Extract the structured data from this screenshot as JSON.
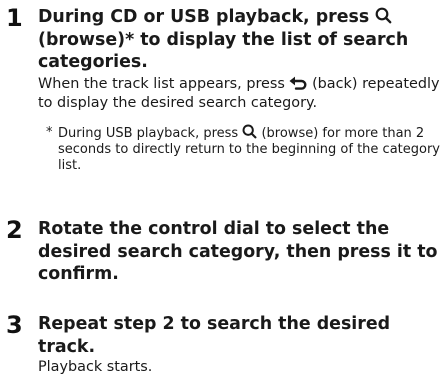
{
  "steps": [
    {
      "number": "1",
      "heading": {
        "before": "During CD or USB playback, press",
        "after": "(browse)* to display the list of search categories."
      },
      "body": {
        "before": "When the track list appears, press",
        "after": "(back) repeatedly to display the desired search category."
      },
      "footnote": {
        "star": "*",
        "before": "During USB playback, press",
        "after": "(browse) for more than 2 seconds to directly return to the beginning of the category list."
      }
    },
    {
      "number": "2",
      "heading": "Rotate the control dial to select the desired search category, then press it to confirm."
    },
    {
      "number": "3",
      "heading": "Repeat step 2 to search the desired track.",
      "body": "Playback starts."
    }
  ],
  "icons": {
    "browse": "magnifier-icon",
    "back": "back-arrow-icon"
  }
}
